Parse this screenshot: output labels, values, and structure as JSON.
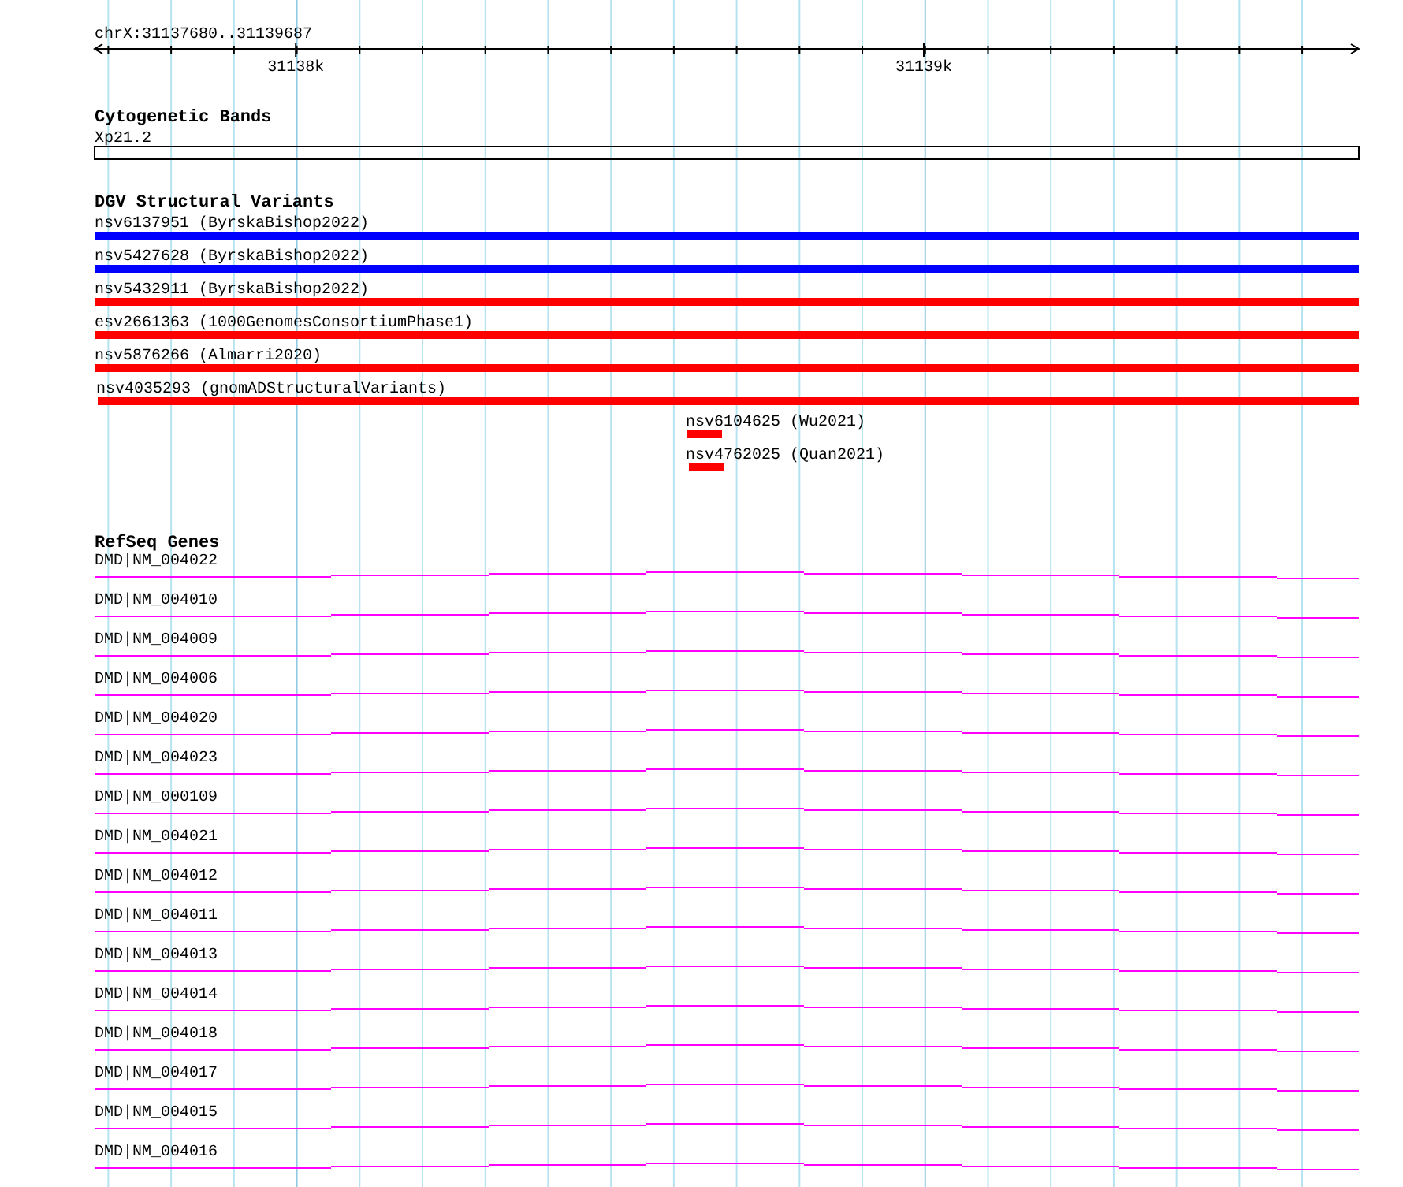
{
  "ruler": {
    "location": "chrX:31137680..31139687",
    "ticks": [
      {
        "label": "31138k"
      },
      {
        "label": "31139k"
      }
    ]
  },
  "tracks": [
    {
      "kind": "cytoband",
      "title": "Cytogenetic Bands",
      "features": [
        {
          "label": "Xp21.2"
        }
      ]
    },
    {
      "kind": "variants",
      "title": "DGV Structural Variants",
      "features": [
        {
          "label": "nsv6137951 (ByrskaBishop2022)",
          "color": "#0000ff",
          "kind": "spanning"
        },
        {
          "label": "nsv5427628 (ByrskaBishop2022)",
          "color": "#0000ff",
          "kind": "spanning"
        },
        {
          "label": "nsv5432911 (ByrskaBishop2022)",
          "color": "#ff0000",
          "kind": "spanning"
        },
        {
          "label": "esv2661363 (1000GenomesConsortiumPhase1)",
          "color": "#ff0000",
          "kind": "spanning"
        },
        {
          "label": "nsv5876266 (Almarri2020)",
          "color": "#ff0000",
          "kind": "spanning"
        },
        {
          "label": "nsv4035293 (gnomADStructuralVariants)",
          "color": "#ff0000",
          "kind": "spanning"
        },
        {
          "label": "nsv6104625 (Wu2021)",
          "color": "#ff0000",
          "kind": "local"
        },
        {
          "label": "nsv4762025 (Quan2021)",
          "color": "#ff0000",
          "kind": "local"
        }
      ]
    },
    {
      "kind": "genes",
      "title": "RefSeq Genes",
      "features": [
        {
          "label": "DMD|NM_004022"
        },
        {
          "label": "DMD|NM_004010"
        },
        {
          "label": "DMD|NM_004009"
        },
        {
          "label": "DMD|NM_004006"
        },
        {
          "label": "DMD|NM_004020"
        },
        {
          "label": "DMD|NM_004023"
        },
        {
          "label": "DMD|NM_000109"
        },
        {
          "label": "DMD|NM_004021"
        },
        {
          "label": "DMD|NM_004012"
        },
        {
          "label": "DMD|NM_004011"
        },
        {
          "label": "DMD|NM_004013"
        },
        {
          "label": "DMD|NM_004014"
        },
        {
          "label": "DMD|NM_004018"
        },
        {
          "label": "DMD|NM_004017"
        },
        {
          "label": "DMD|NM_004015"
        },
        {
          "label": "DMD|NM_004016"
        }
      ]
    }
  ]
}
